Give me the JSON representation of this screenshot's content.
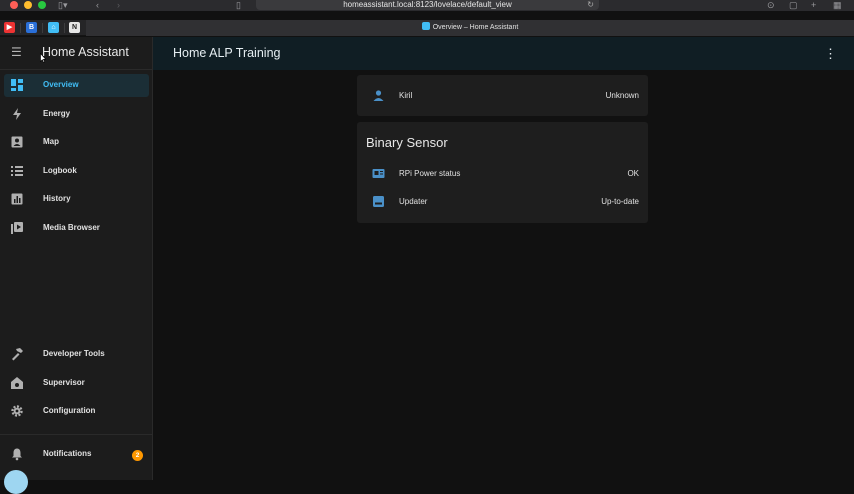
{
  "browser": {
    "url": "homeassistant.local:8123/lovelace/default_view",
    "tab_title": "Overview – Home Assistant"
  },
  "app": {
    "title": "Home Assistant",
    "view_title": "Home ALP Training"
  },
  "sidebar": {
    "items": [
      {
        "label": "Overview",
        "icon": "dashboard-icon",
        "active": true
      },
      {
        "label": "Energy",
        "icon": "lightning-icon"
      },
      {
        "label": "Map",
        "icon": "map-icon"
      },
      {
        "label": "Logbook",
        "icon": "logbook-icon"
      },
      {
        "label": "History",
        "icon": "history-icon"
      },
      {
        "label": "Media Browser",
        "icon": "media-icon"
      }
    ],
    "bottom_items": [
      {
        "label": "Developer Tools",
        "icon": "hammer-icon"
      },
      {
        "label": "Supervisor",
        "icon": "supervisor-icon"
      },
      {
        "label": "Configuration",
        "icon": "gear-icon"
      }
    ],
    "notifications": {
      "label": "Notifications",
      "count": "2"
    }
  },
  "cards": {
    "person": {
      "name": "Kiril",
      "state": "Unknown"
    },
    "binary_sensor": {
      "title": "Binary Sensor",
      "rows": [
        {
          "name": "RPi Power status",
          "state": "OK"
        },
        {
          "name": "Updater",
          "state": "Up-to-date"
        }
      ]
    }
  },
  "colors": {
    "accent": "#41bdf5",
    "badge": "#ff9800",
    "icon": "#b0b0b0"
  }
}
